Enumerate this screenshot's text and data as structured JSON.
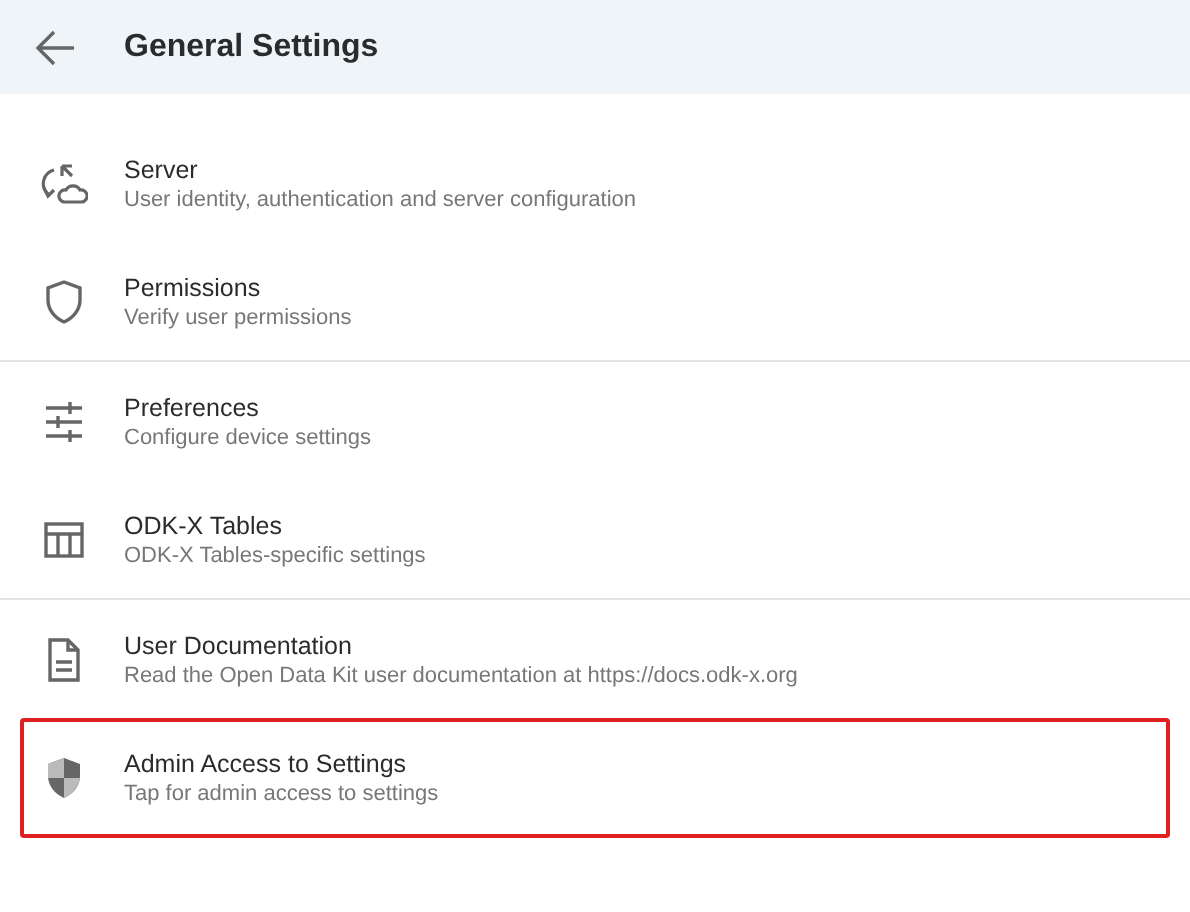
{
  "app_bar": {
    "title": "General Settings"
  },
  "sections": [
    {
      "items": [
        {
          "kind": "server",
          "title": "Server",
          "subtitle": "User identity, authentication and server configuration",
          "highlighted": false
        },
        {
          "kind": "permissions",
          "title": "Permissions",
          "subtitle": "Verify user permissions",
          "highlighted": false
        }
      ]
    },
    {
      "items": [
        {
          "kind": "preferences",
          "title": "Preferences",
          "subtitle": "Configure device settings",
          "highlighted": false
        },
        {
          "kind": "tables",
          "title": "ODK-X Tables",
          "subtitle": "ODK-X Tables-specific settings",
          "highlighted": false
        }
      ]
    },
    {
      "items": [
        {
          "kind": "documentation",
          "title": "User Documentation",
          "subtitle": "Read the Open Data Kit user documentation at https://docs.odk-x.org",
          "highlighted": false
        },
        {
          "kind": "admin",
          "title": "Admin Access to Settings",
          "subtitle": "Tap for admin access to settings",
          "highlighted": true
        }
      ]
    }
  ]
}
